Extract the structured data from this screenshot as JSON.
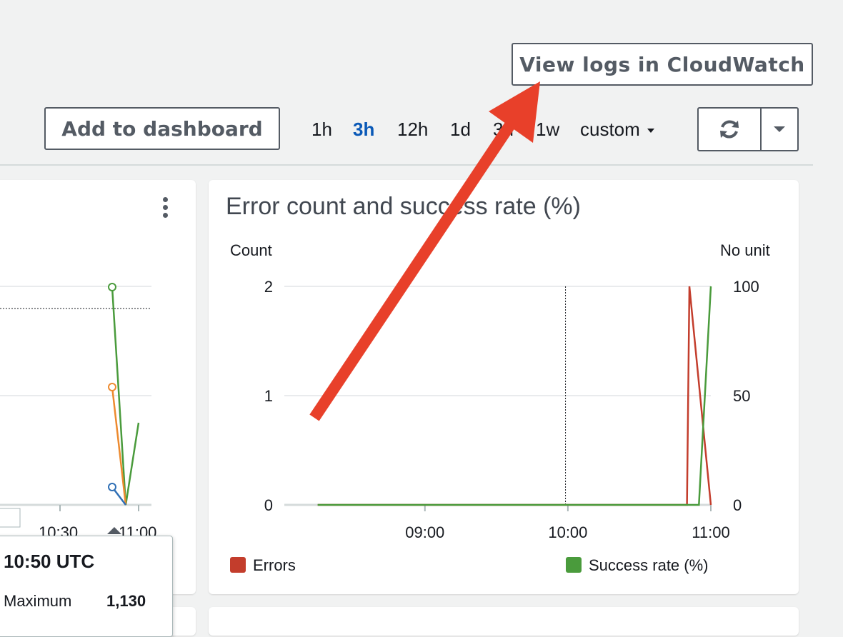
{
  "toolbar": {
    "view_logs_label": "View logs in CloudWatch",
    "add_dashboard_label": "Add to dashboard",
    "ranges": [
      "1h",
      "3h",
      "12h",
      "1d",
      "3d",
      "1w"
    ],
    "active_range": "3h",
    "custom_label": "custom",
    "refresh_icon": "refresh-icon",
    "dropdown_icon": "caret-down-icon"
  },
  "left_panel": {
    "menu_icon": "kebab-menu-icon",
    "x_ticks": [
      "10:30",
      "11:00"
    ],
    "tooltip": {
      "time": "10:50 UTC",
      "stat_label": "Maximum",
      "stat_value": "1,130"
    }
  },
  "right_panel": {
    "title": "Error count and success rate (%)",
    "left_axis_label": "Count",
    "right_axis_label": "No unit"
  },
  "annotation": {
    "color": "#e8402a"
  },
  "chart_data": {
    "type": "line",
    "title": "Error count and success rate (%)",
    "x": [
      "08:15",
      "09:00",
      "10:00",
      "10:50",
      "10:55",
      "11:00"
    ],
    "x_ticks": [
      "09:00",
      "10:00",
      "11:00"
    ],
    "y_left": {
      "label": "Count",
      "ticks": [
        0,
        1,
        2
      ],
      "range": [
        0,
        2
      ]
    },
    "y_right": {
      "label": "No unit",
      "ticks": [
        0,
        50,
        100
      ],
      "range": [
        0,
        100
      ]
    },
    "series": [
      {
        "name": "Errors",
        "axis": "left",
        "color": "#c33d2c",
        "points": [
          [
            "08:15",
            0
          ],
          [
            "10:50",
            0
          ],
          [
            "10:51",
            2
          ],
          [
            "11:00",
            0
          ]
        ]
      },
      {
        "name": "Success rate (%)",
        "axis": "right",
        "color": "#4a9b3c",
        "points": [
          [
            "08:15",
            0
          ],
          [
            "10:55",
            0
          ],
          [
            "11:00",
            100
          ]
        ]
      }
    ],
    "grid": true,
    "legend": "bottom"
  }
}
